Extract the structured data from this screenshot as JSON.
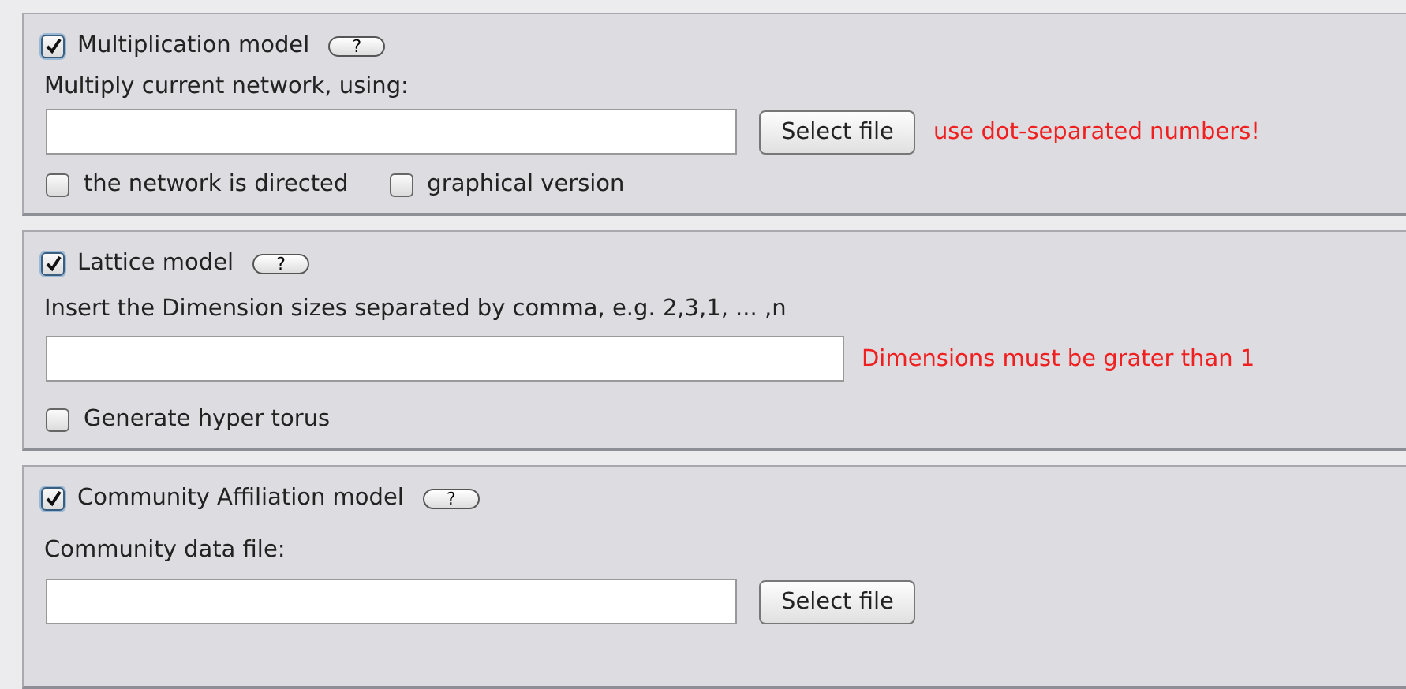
{
  "sections": [
    {
      "title": "Multiplication model",
      "checked": true,
      "help": "?",
      "label": "Multiply current network, using:",
      "button": "Select file",
      "warning": "use dot-separated numbers!",
      "options": [
        {
          "label": "the network is directed",
          "checked": false
        },
        {
          "label": "graphical version",
          "checked": false
        }
      ]
    },
    {
      "title": "Lattice model",
      "checked": true,
      "help": "?",
      "label": "Insert the Dimension sizes separated by comma, e.g. 2,3,1, ... ,n",
      "warning": "Dimensions must be grater than 1",
      "options": [
        {
          "label": "Generate hyper torus",
          "checked": false
        }
      ]
    },
    {
      "title": "Community Affiliation model",
      "checked": true,
      "help": "?",
      "label": "Community data file:",
      "button": "Select file"
    }
  ]
}
